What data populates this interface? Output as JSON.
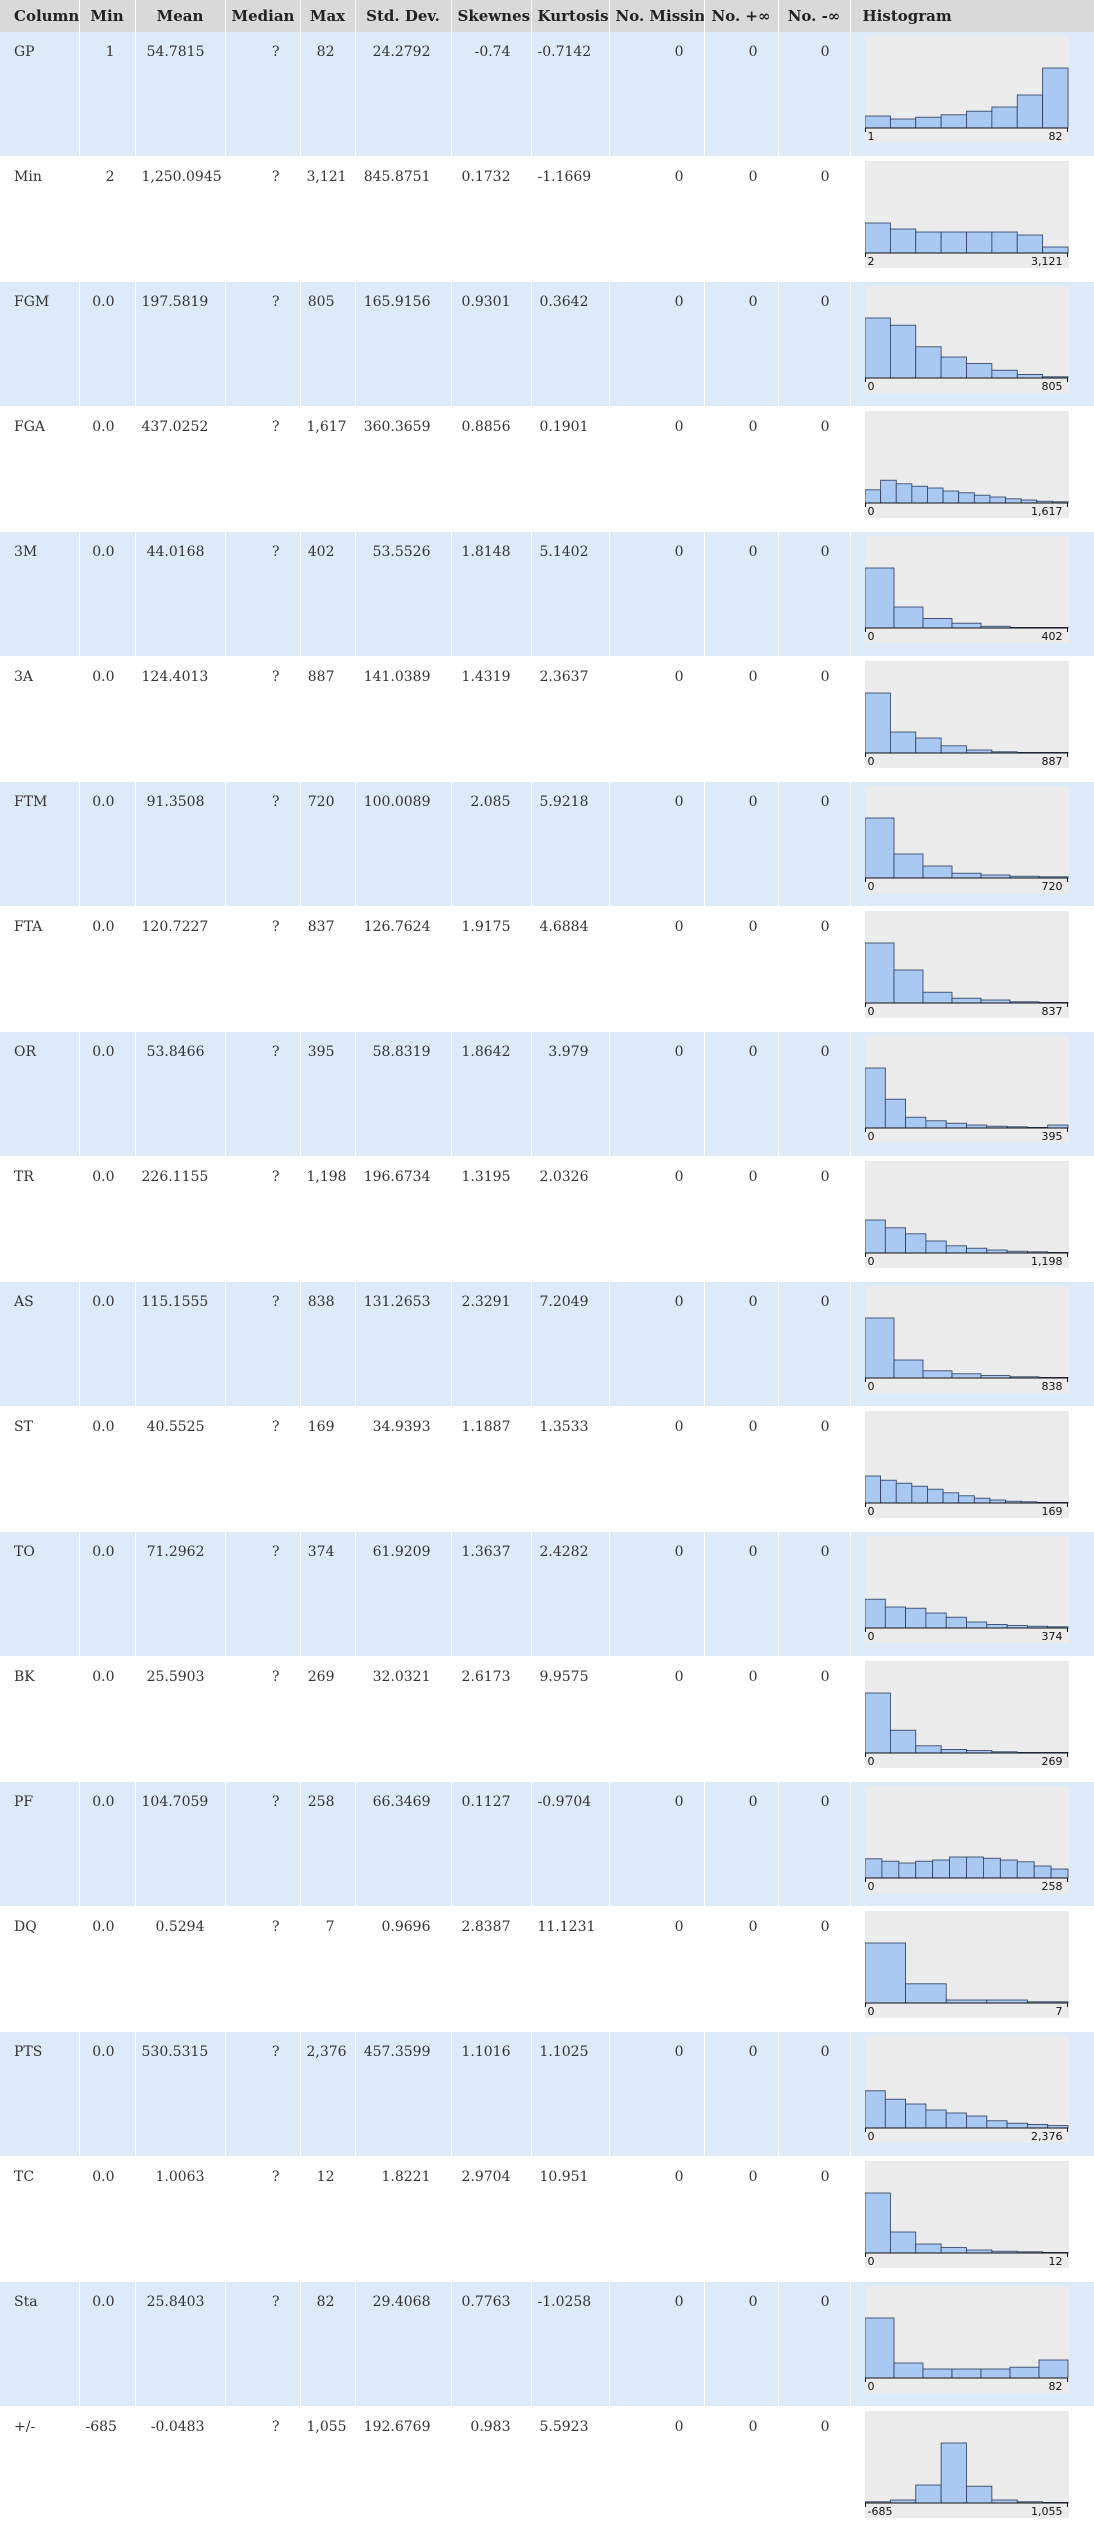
{
  "headers": {
    "column": "Column",
    "min": "Min",
    "mean": "Mean",
    "median": "Median",
    "max": "Max",
    "std": "Std. Dev.",
    "skew": "Skewness",
    "kurt": "Kurtosis",
    "missing": "No. Missing",
    "pinf": "No. +∞",
    "ninf": "No. -∞",
    "hist": "Histogram"
  },
  "colors": {
    "header_bg": "#d9d9d9",
    "row_alt_bg": "#ddeafa",
    "hist_bg": "#ebebeb",
    "bar_fill": "#a9c8f2",
    "bar_stroke": "#2a3a5c"
  },
  "rows": [
    {
      "name": "GP",
      "min": "1",
      "mean": "54.7815",
      "median": "?",
      "max": "82",
      "std": "24.2792",
      "skew": "-0.74",
      "kurt": "-0.7142",
      "missing": "0",
      "pinf": "0",
      "ninf": "0",
      "hist_min": "1",
      "hist_max": "82",
      "bins": [
        0.2,
        0.15,
        0.18,
        0.22,
        0.28,
        0.35,
        0.55,
        1.0
      ]
    },
    {
      "name": "Min",
      "min": "2",
      "mean": "1,250.0945",
      "median": "?",
      "max": "3,121",
      "std": "845.8751",
      "skew": "0.1732",
      "kurt": "-1.1669",
      "missing": "0",
      "pinf": "0",
      "ninf": "0",
      "hist_min": "2",
      "hist_max": "3,121",
      "bins": [
        0.5,
        0.4,
        0.35,
        0.35,
        0.35,
        0.35,
        0.3,
        0.1
      ]
    },
    {
      "name": "FGM",
      "min": "0.0",
      "mean": "197.5819",
      "median": "?",
      "max": "805",
      "std": "165.9156",
      "skew": "0.9301",
      "kurt": "0.3642",
      "missing": "0",
      "pinf": "0",
      "ninf": "0",
      "hist_min": "0",
      "hist_max": "805",
      "bins": [
        1.0,
        0.88,
        0.52,
        0.35,
        0.24,
        0.13,
        0.06,
        0.02
      ]
    },
    {
      "name": "FGA",
      "min": "0.0",
      "mean": "437.0252",
      "median": "?",
      "max": "1,617",
      "std": "360.3659",
      "skew": "0.8856",
      "kurt": "0.1901",
      "missing": "0",
      "pinf": "0",
      "ninf": "0",
      "hist_min": "0",
      "hist_max": "1,617",
      "bins": [
        0.22,
        0.38,
        0.32,
        0.28,
        0.25,
        0.2,
        0.17,
        0.13,
        0.1,
        0.07,
        0.05,
        0.03,
        0.02
      ]
    },
    {
      "name": "3M",
      "min": "0.0",
      "mean": "44.0168",
      "median": "?",
      "max": "402",
      "std": "53.5526",
      "skew": "1.8148",
      "kurt": "5.1402",
      "missing": "0",
      "pinf": "0",
      "ninf": "0",
      "hist_min": "0",
      "hist_max": "402",
      "bins": [
        1.0,
        0.35,
        0.16,
        0.08,
        0.03,
        0.01,
        0.01
      ]
    },
    {
      "name": "3A",
      "min": "0.0",
      "mean": "124.4013",
      "median": "?",
      "max": "887",
      "std": "141.0389",
      "skew": "1.4319",
      "kurt": "2.3637",
      "missing": "0",
      "pinf": "0",
      "ninf": "0",
      "hist_min": "0",
      "hist_max": "887",
      "bins": [
        1.0,
        0.35,
        0.25,
        0.12,
        0.05,
        0.02,
        0.01,
        0.01
      ]
    },
    {
      "name": "FTM",
      "min": "0.0",
      "mean": "91.3508",
      "median": "?",
      "max": "720",
      "std": "100.0089",
      "skew": "2.085",
      "kurt": "5.9218",
      "missing": "0",
      "pinf": "0",
      "ninf": "0",
      "hist_min": "0",
      "hist_max": "720",
      "bins": [
        1.0,
        0.4,
        0.2,
        0.08,
        0.05,
        0.03,
        0.02
      ]
    },
    {
      "name": "FTA",
      "min": "0.0",
      "mean": "120.7227",
      "median": "?",
      "max": "837",
      "std": "126.7624",
      "skew": "1.9175",
      "kurt": "4.6884",
      "missing": "0",
      "pinf": "0",
      "ninf": "0",
      "hist_min": "0",
      "hist_max": "837",
      "bins": [
        1.0,
        0.55,
        0.18,
        0.08,
        0.05,
        0.02,
        0.01
      ]
    },
    {
      "name": "OR",
      "min": "0.0",
      "mean": "53.8466",
      "median": "?",
      "max": "395",
      "std": "58.8319",
      "skew": "1.8642",
      "kurt": "3.979",
      "missing": "0",
      "pinf": "0",
      "ninf": "0",
      "hist_min": "0",
      "hist_max": "395",
      "bins": [
        1.0,
        0.48,
        0.18,
        0.12,
        0.08,
        0.05,
        0.03,
        0.02,
        0.01,
        0.05
      ]
    },
    {
      "name": "TR",
      "min": "0.0",
      "mean": "226.1155",
      "median": "?",
      "max": "1,198",
      "std": "196.6734",
      "skew": "1.3195",
      "kurt": "2.0326",
      "missing": "0",
      "pinf": "0",
      "ninf": "0",
      "hist_min": "0",
      "hist_max": "1,198",
      "bins": [
        0.55,
        0.42,
        0.32,
        0.2,
        0.12,
        0.08,
        0.05,
        0.03,
        0.02,
        0.01
      ]
    },
    {
      "name": "AS",
      "min": "0.0",
      "mean": "115.1555",
      "median": "?",
      "max": "838",
      "std": "131.2653",
      "skew": "2.3291",
      "kurt": "7.2049",
      "missing": "0",
      "pinf": "0",
      "ninf": "0",
      "hist_min": "0",
      "hist_max": "838",
      "bins": [
        1.0,
        0.3,
        0.12,
        0.07,
        0.04,
        0.02,
        0.01
      ]
    },
    {
      "name": "ST",
      "min": "0.0",
      "mean": "40.5525",
      "median": "?",
      "max": "169",
      "std": "34.9393",
      "skew": "1.1887",
      "kurt": "1.3533",
      "missing": "0",
      "pinf": "0",
      "ninf": "0",
      "hist_min": "0",
      "hist_max": "169",
      "bins": [
        0.45,
        0.38,
        0.33,
        0.28,
        0.23,
        0.17,
        0.12,
        0.08,
        0.05,
        0.03,
        0.02,
        0.01,
        0.01
      ]
    },
    {
      "name": "TO",
      "min": "0.0",
      "mean": "71.2962",
      "median": "?",
      "max": "374",
      "std": "61.9209",
      "skew": "1.3637",
      "kurt": "2.4282",
      "missing": "0",
      "pinf": "0",
      "ninf": "0",
      "hist_min": "0",
      "hist_max": "374",
      "bins": [
        0.48,
        0.35,
        0.33,
        0.25,
        0.18,
        0.1,
        0.06,
        0.04,
        0.03,
        0.02
      ]
    },
    {
      "name": "BK",
      "min": "0.0",
      "mean": "25.5903",
      "median": "?",
      "max": "269",
      "std": "32.0321",
      "skew": "2.6173",
      "kurt": "9.9575",
      "missing": "0",
      "pinf": "0",
      "ninf": "0",
      "hist_min": "0",
      "hist_max": "269",
      "bins": [
        1.0,
        0.38,
        0.12,
        0.06,
        0.04,
        0.02,
        0.01,
        0.01
      ]
    },
    {
      "name": "PF",
      "min": "0.0",
      "mean": "104.7059",
      "median": "?",
      "max": "258",
      "std": "66.3469",
      "skew": "0.1127",
      "kurt": "-0.9704",
      "missing": "0",
      "pinf": "0",
      "ninf": "0",
      "hist_min": "0",
      "hist_max": "258",
      "bins": [
        0.32,
        0.28,
        0.25,
        0.28,
        0.3,
        0.35,
        0.35,
        0.33,
        0.3,
        0.27,
        0.2,
        0.15
      ]
    },
    {
      "name": "DQ",
      "min": "0.0",
      "mean": "0.5294",
      "median": "?",
      "max": "7",
      "std": "0.9696",
      "skew": "2.8387",
      "kurt": "11.1231",
      "missing": "0",
      "pinf": "0",
      "ninf": "0",
      "hist_min": "0",
      "hist_max": "7",
      "bins": [
        1.0,
        0.32,
        0.05,
        0.05,
        0.02
      ]
    },
    {
      "name": "PTS",
      "min": "0.0",
      "mean": "530.5315",
      "median": "?",
      "max": "2,376",
      "std": "457.3599",
      "skew": "1.1016",
      "kurt": "1.1025",
      "missing": "0",
      "pinf": "0",
      "ninf": "0",
      "hist_min": "0",
      "hist_max": "2,376",
      "bins": [
        0.62,
        0.48,
        0.4,
        0.3,
        0.25,
        0.2,
        0.12,
        0.08,
        0.06,
        0.04
      ]
    },
    {
      "name": "TC",
      "min": "0.0",
      "mean": "1.0063",
      "median": "?",
      "max": "12",
      "std": "1.8221",
      "skew": "2.9704",
      "kurt": "10.951",
      "missing": "0",
      "pinf": "0",
      "ninf": "0",
      "hist_min": "0",
      "hist_max": "12",
      "bins": [
        1.0,
        0.35,
        0.15,
        0.09,
        0.05,
        0.03,
        0.02,
        0.01
      ]
    },
    {
      "name": "Sta",
      "min": "0.0",
      "mean": "25.8403",
      "median": "?",
      "max": "82",
      "std": "29.4068",
      "skew": "0.7763",
      "kurt": "-1.0258",
      "missing": "0",
      "pinf": "0",
      "ninf": "0",
      "hist_min": "0",
      "hist_max": "82",
      "bins": [
        1.0,
        0.25,
        0.15,
        0.15,
        0.15,
        0.18,
        0.3
      ]
    },
    {
      "name": "+/-",
      "min": "-685",
      "mean": "-0.0483",
      "median": "?",
      "max": "1,055",
      "std": "192.6769",
      "skew": "0.983",
      "kurt": "5.5923",
      "missing": "0",
      "pinf": "0",
      "ninf": "0",
      "hist_min": "-685",
      "hist_max": "1,055",
      "bins": [
        0.02,
        0.05,
        0.3,
        1.0,
        0.28,
        0.05,
        0.02,
        0.01
      ]
    }
  ]
}
